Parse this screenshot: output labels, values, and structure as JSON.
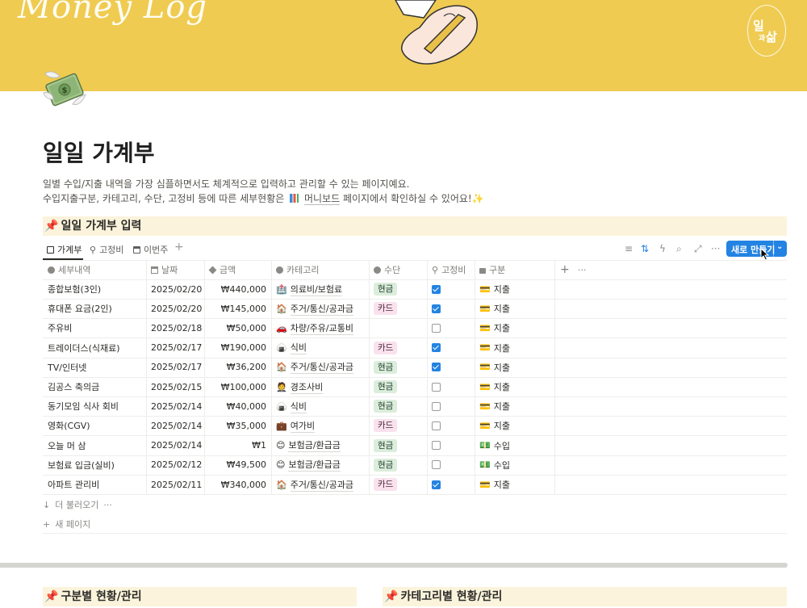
{
  "cover": {
    "title": "Money Log",
    "badge": [
      "일",
      "과",
      "삶"
    ],
    "bg_color": "#efcb52"
  },
  "page": {
    "icon": "money-with-wings",
    "title": "일일 가계부",
    "desc_line1": "일별 수입/지출 내역을 가장 심플하면서도 체계적으로 입력하고 관리할 수 있는 페이지예요.",
    "desc_line2_before": "수입지출구분, 카테고리, 수단, 고정비 등에 따른 세부현황은",
    "desc_link": "머니보드",
    "desc_line2_after": "페이지에서 확인하실 수 있어요!"
  },
  "section_title": "일일 가계부 입력",
  "views": {
    "tabs": [
      "가계부",
      "고정비",
      "이번주"
    ],
    "active": "가계부",
    "new_button": "새로 만들기"
  },
  "columns": [
    "세부내역",
    "날짜",
    "금액",
    "카테고리",
    "수단",
    "고정비",
    "구분"
  ],
  "rows": [
    {
      "name": "종합보험(3인)",
      "date": "2025/02/20",
      "amount": "₩440,000",
      "cat": "의료비/보험료",
      "cat_icon": "hospital",
      "method": "현금",
      "fixed": true,
      "type": "지출"
    },
    {
      "name": "휴대폰 요금(2인)",
      "date": "2025/02/20",
      "amount": "₩145,000",
      "cat": "주거/통신/공과금",
      "cat_icon": "house",
      "method": "카드",
      "fixed": true,
      "type": "지출"
    },
    {
      "name": "주유비",
      "date": "2025/02/18",
      "amount": "₩50,000",
      "cat": "차량/주유/교통비",
      "cat_icon": "car",
      "method": "",
      "fixed": false,
      "type": "지출"
    },
    {
      "name": "트레이더스(식재료)",
      "date": "2025/02/17",
      "amount": "₩190,000",
      "cat": "식비",
      "cat_icon": "dumpling",
      "method": "카드",
      "fixed": true,
      "type": "지출"
    },
    {
      "name": "TV/인터넷",
      "date": "2025/02/17",
      "amount": "₩36,200",
      "cat": "주거/통신/공과금",
      "cat_icon": "house",
      "method": "현금",
      "fixed": true,
      "type": "지출"
    },
    {
      "name": "김공스 축의금",
      "date": "2025/02/15",
      "amount": "₩100,000",
      "cat": "경조사비",
      "cat_icon": "person",
      "method": "현금",
      "fixed": false,
      "type": "지출"
    },
    {
      "name": "동기모임 식사 회비",
      "date": "2025/02/14",
      "amount": "₩40,000",
      "cat": "식비",
      "cat_icon": "dumpling",
      "method": "현금",
      "fixed": false,
      "type": "지출"
    },
    {
      "name": "영화(CGV)",
      "date": "2025/02/14",
      "amount": "₩35,000",
      "cat": "여가비",
      "cat_icon": "bag",
      "method": "카드",
      "fixed": false,
      "type": "지출"
    },
    {
      "name": "오늘 머 삼",
      "date": "2025/02/14",
      "amount": "₩1",
      "cat": "보험금/환급금",
      "cat_icon": "smile",
      "method": "현금",
      "fixed": false,
      "type": "수입"
    },
    {
      "name": "보험료 입금(실비)",
      "date": "2025/02/12",
      "amount": "₩49,500",
      "cat": "보험금/환급금",
      "cat_icon": "smile",
      "method": "현금",
      "fixed": false,
      "type": "수입"
    },
    {
      "name": "아파트 관리비",
      "date": "2025/02/11",
      "amount": "₩340,000",
      "cat": "주거/통신/공과금",
      "cat_icon": "house",
      "method": "카드",
      "fixed": true,
      "type": "지출"
    }
  ],
  "footer": {
    "load_more": "더 불러오기",
    "new_page": "새 페이지"
  },
  "bottom_sections": [
    "구분별 현황/관리",
    "카테고리별 현황/관리"
  ]
}
